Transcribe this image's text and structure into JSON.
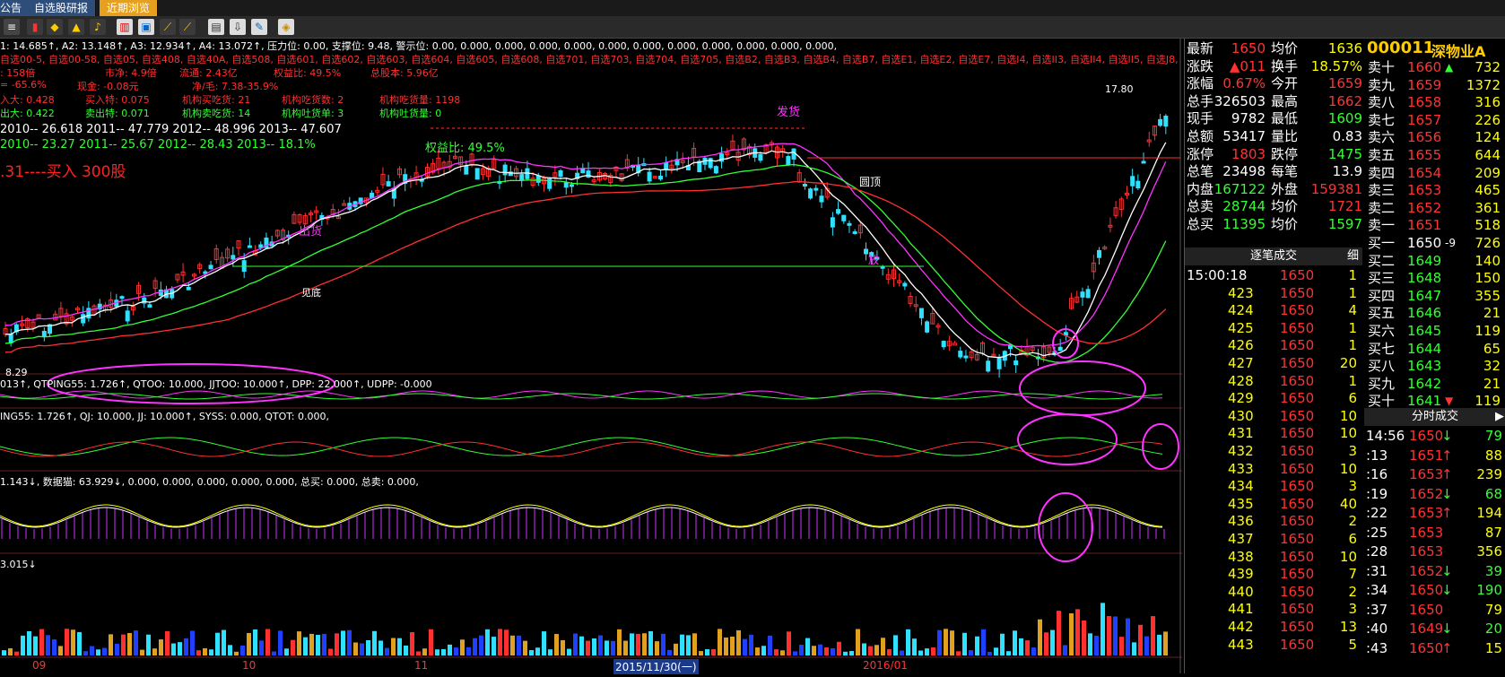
{
  "tabs": [
    {
      "label": "公告"
    },
    {
      "label": "自选股研报"
    },
    {
      "label": "近期浏览"
    }
  ],
  "indicator_rows": {
    "r1": "1: 14.685↑, A2: 13.148↑, A3: 12.934↑, A4: 13.072↑, 压力位: 0.00, 支撑位: 9.48, 警示位: 0.00, 0.000, 0.000, 0.000, 0.000, 0.000, 0.000, 0.000, 0.000, 0.000, 0.000, 0.000,",
    "r2": "自选00-5, 自选00-58, 自选05, 自选408, 自选40A, 自选508, 自选601, 自选602, 自选603, 自选604, 自选605, 自选608, 自选701, 自选703, 自选704, 自选705, 自选B2, 自选B3, 自选B4, 自选B7, 自选E1, 自选E2, 自选E7, 自选I4, 自选II3, 自选II4, 自选II5, 自选J8, 自选",
    "r3a": ": 158倍",
    "r3b": "市净: 4.9倍",
    "r3c": "流通: 2.43亿",
    "r3d": "权益比: 49.5%",
    "r3e": "总股本: 5.96亿",
    "r4a": "= -65.6%",
    "r4b": "现金: -0.08元",
    "r4c": "净/毛: 7.38-35.9%",
    "r5a": "入大: 0.428",
    "r5b": "买入特: 0.075",
    "r5c": "机构买吃货: 21",
    "r5d": "机构吃货数: 2",
    "r5e": "机构吃货量: 1198",
    "r6a": "出大: 0.422",
    "r6b": "卖出特: 0.071",
    "r6c": "机构卖吃货: 14",
    "r6d": "机构吐货单: 3",
    "r6e": "机构吐货量: 0",
    "r7": "2010-- 26.618    2011-- 47.779    2012-- 48.996    2013-- 47.607",
    "r8": "2010-- 23.27    2011-- 25.67    2012-- 28.43    2013-- 18.1%",
    "r8b": "权益比: 49.5%",
    "buy_note": ".31----买入 300股",
    "sub1": "013↑, QTPING55: 1.726↑, QTOO: 10.000, JJTOO: 10.000↑, DPP: 22.000↑, UDPP: -0.000",
    "sub2": "ING55: 1.726↑, QJ: 10.000, JJ: 10.000↑, SYSS: 0.000, QTOT: 0.000,",
    "sub3": "1.143↓, 数据猫: 63.929↓, 0.000, 0.000, 0.000, 0.000, 0.000, 总买: 0.000, 总卖: 0.000,",
    "sub4": "3.015↓"
  },
  "chart_labels": {
    "fahuo": "发货",
    "chuhuo": "出货",
    "jianbai": "见底",
    "yuanding": "圆顶",
    "fangliang": "放",
    "price_high": "17.80",
    "price_low": "8.29",
    "xaxis": [
      "09",
      "10",
      "11",
      "2015/11/30(一)",
      "2016/01"
    ]
  },
  "quote": {
    "stock_code": "000011",
    "stock_name": "深物业A",
    "rows": [
      {
        "l1": "最新",
        "v1": "1650",
        "l2": "均价",
        "v2": "1636"
      },
      {
        "l1": "涨跌",
        "v1": "▲011",
        "l2": "换手",
        "v2": "18.57%"
      },
      {
        "l1": "涨幅",
        "v1": "0.67%",
        "l2": "今开",
        "v2": "1659"
      },
      {
        "l1": "总手",
        "v1": "326503",
        "l2": "最高",
        "v2": "1662"
      },
      {
        "l1": "现手",
        "v1": "9782",
        "l2": "最低",
        "v2": "1609"
      },
      {
        "l1": "总额",
        "v1": "53417",
        "l2": "量比",
        "v2": "0.83"
      },
      {
        "l1": "涨停",
        "v1": "1803",
        "l2": "跌停",
        "v2": "1475"
      },
      {
        "l1": "总笔",
        "v1": "23498",
        "l2": "每笔",
        "v2": "13.9"
      },
      {
        "l1": "内盘",
        "v1": "167122",
        "l2": "外盘",
        "v2": "159381"
      },
      {
        "l1": "总卖",
        "v1": "28744",
        "l2": "均价",
        "v2": "1721"
      },
      {
        "l1": "总买",
        "v1": "11395",
        "l2": "均价",
        "v2": "1597"
      }
    ],
    "colors": {
      "up": "#ff3333",
      "down": "#33ff33",
      "neutral": "#ffffff"
    }
  },
  "orderbook": [
    {
      "label": "卖十",
      "price": "1660",
      "vol": "732",
      "mark": "▲"
    },
    {
      "label": "卖九",
      "price": "1659",
      "vol": "1372",
      "mark": ""
    },
    {
      "label": "卖八",
      "price": "1658",
      "vol": "316",
      "mark": ""
    },
    {
      "label": "卖七",
      "price": "1657",
      "vol": "226",
      "mark": ""
    },
    {
      "label": "卖六",
      "price": "1656",
      "vol": "124",
      "mark": ""
    },
    {
      "label": "卖五",
      "price": "1655",
      "vol": "644",
      "mark": ""
    },
    {
      "label": "卖四",
      "price": "1654",
      "vol": "209",
      "mark": ""
    },
    {
      "label": "卖三",
      "price": "1653",
      "vol": "465",
      "mark": ""
    },
    {
      "label": "卖二",
      "price": "1652",
      "vol": "361",
      "mark": ""
    },
    {
      "label": "卖一",
      "price": "1651",
      "vol": "518",
      "mark": ""
    },
    {
      "label": "买一",
      "price": "1650",
      "vol": "726",
      "mark": "-9"
    },
    {
      "label": "买二",
      "price": "1649",
      "vol": "140",
      "mark": ""
    },
    {
      "label": "买三",
      "price": "1648",
      "vol": "150",
      "mark": ""
    },
    {
      "label": "买四",
      "price": "1647",
      "vol": "355",
      "mark": ""
    },
    {
      "label": "买五",
      "price": "1646",
      "vol": "21",
      "mark": ""
    },
    {
      "label": "买六",
      "price": "1645",
      "vol": "119",
      "mark": ""
    },
    {
      "label": "买七",
      "price": "1644",
      "vol": "65",
      "mark": ""
    },
    {
      "label": "买八",
      "price": "1643",
      "vol": "32",
      "mark": ""
    },
    {
      "label": "买九",
      "price": "1642",
      "vol": "21",
      "mark": ""
    },
    {
      "label": "买十",
      "price": "1641",
      "vol": "119",
      "mark": "▼"
    }
  ],
  "tick_panel": {
    "title": "逐笔成交",
    "tab": "细",
    "first_time": "15:00:18",
    "rows": [
      {
        "id": "",
        "price": "1650",
        "vol": "1"
      },
      {
        "id": "423",
        "price": "1650",
        "vol": "1"
      },
      {
        "id": "424",
        "price": "1650",
        "vol": "4"
      },
      {
        "id": "425",
        "price": "1650",
        "vol": "1"
      },
      {
        "id": "426",
        "price": "1650",
        "vol": "1"
      },
      {
        "id": "427",
        "price": "1650",
        "vol": "20"
      },
      {
        "id": "428",
        "price": "1650",
        "vol": "1"
      },
      {
        "id": "429",
        "price": "1650",
        "vol": "6"
      },
      {
        "id": "430",
        "price": "1650",
        "vol": "10"
      },
      {
        "id": "431",
        "price": "1650",
        "vol": "10"
      },
      {
        "id": "432",
        "price": "1650",
        "vol": "3"
      },
      {
        "id": "433",
        "price": "1650",
        "vol": "10"
      },
      {
        "id": "434",
        "price": "1650",
        "vol": "3"
      },
      {
        "id": "435",
        "price": "1650",
        "vol": "40"
      },
      {
        "id": "436",
        "price": "1650",
        "vol": "2"
      },
      {
        "id": "437",
        "price": "1650",
        "vol": "6"
      },
      {
        "id": "438",
        "price": "1650",
        "vol": "10"
      },
      {
        "id": "439",
        "price": "1650",
        "vol": "7"
      },
      {
        "id": "440",
        "price": "1650",
        "vol": "2"
      },
      {
        "id": "441",
        "price": "1650",
        "vol": "3"
      },
      {
        "id": "442",
        "price": "1650",
        "vol": "13"
      },
      {
        "id": "443",
        "price": "1650",
        "vol": "5"
      }
    ]
  },
  "minute_panel": {
    "title": "分时成交",
    "rows": [
      {
        "t": "14:56",
        "p": "1650",
        "a": "↓",
        "v": "79"
      },
      {
        "t": ":13",
        "p": "1651",
        "a": "↑",
        "v": "88"
      },
      {
        "t": ":16",
        "p": "1653",
        "a": "↑",
        "v": "239"
      },
      {
        "t": ":19",
        "p": "1652",
        "a": "↓",
        "v": "68"
      },
      {
        "t": ":22",
        "p": "1653",
        "a": "↑",
        "v": "194"
      },
      {
        "t": ":25",
        "p": "1653",
        "a": "",
        "v": "87"
      },
      {
        "t": ":28",
        "p": "1653",
        "a": "",
        "v": "356"
      },
      {
        "t": ":31",
        "p": "1652",
        "a": "↓",
        "v": "39"
      },
      {
        "t": ":34",
        "p": "1650",
        "a": "↓",
        "v": "190"
      },
      {
        "t": ":37",
        "p": "1650",
        "a": "",
        "v": "79"
      },
      {
        "t": ":40",
        "p": "1649",
        "a": "↓",
        "v": "20"
      },
      {
        "t": ":43",
        "p": "1650",
        "a": "↑",
        "v": "15"
      }
    ]
  }
}
